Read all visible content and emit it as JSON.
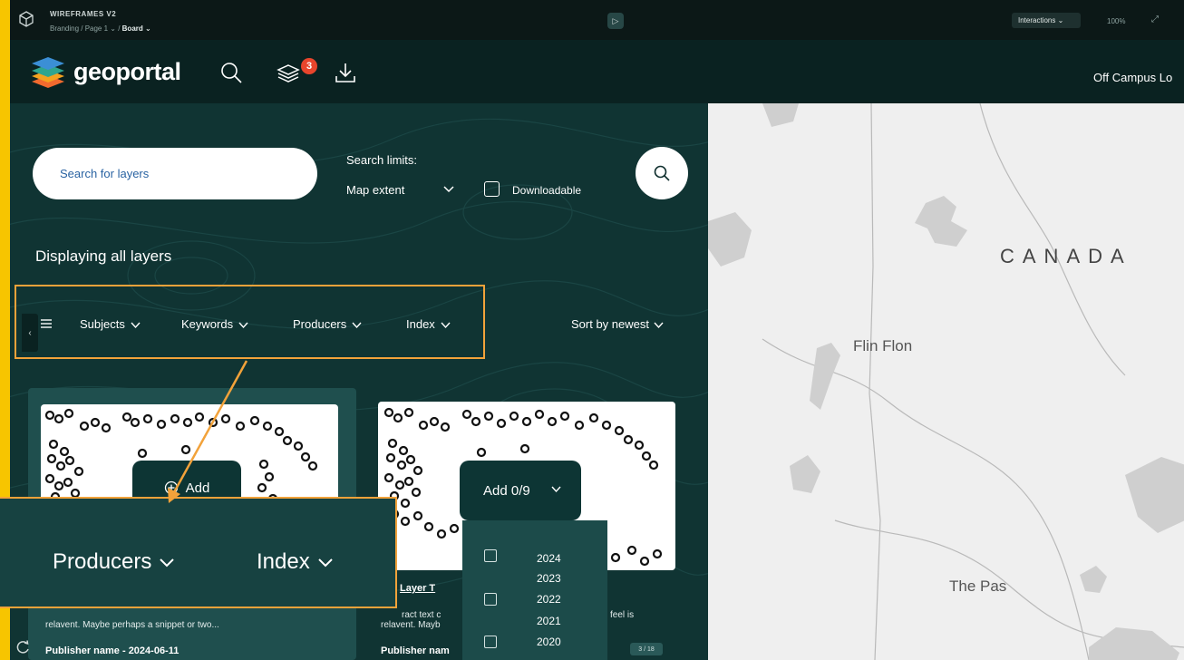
{
  "toolbar": {
    "title": "WIREFRAMES V2",
    "path_prefix": "Branding / Page 1 ⌄ /",
    "path_board": "Board ⌄",
    "interactions_label": "Interactions ⌄",
    "zoom_level": "100%"
  },
  "header": {
    "logo_text": "geoportal",
    "layers_badge_count": "3",
    "off_campus_label": "Off Campus Lo"
  },
  "search": {
    "placeholder": "Search for layers",
    "limits_label": "Search limits:",
    "map_extent_label": "Map extent",
    "downloadable_label": "Downloadable"
  },
  "displaying_label": "Displaying all layers",
  "filters": {
    "subjects": "Subjects",
    "keywords": "Keywords",
    "producers": "Producers",
    "index": "Index",
    "sort": "Sort by newest"
  },
  "cards": [
    {
      "add_label": "Add",
      "snippet": "relavent. Maybe perhaps a snippet or two...",
      "publisher": "Publisher name - 2024-06-11"
    },
    {
      "add_label": "Add 0/9",
      "title": "Layer T",
      "snippet_a": "ract text c",
      "snippet_b": "relavent. Mayb",
      "snippet_c": "feel is",
      "publisher": "Publisher nam",
      "page_badge": "3 / 18"
    }
  ],
  "year_options": [
    "2024",
    "2023",
    "2022",
    "2021",
    "2020"
  ],
  "callout": {
    "producers": "Producers",
    "index": "Index"
  },
  "map": {
    "country_label": "CANADA",
    "places": [
      "Flin Flon",
      "The Pas"
    ]
  },
  "colors": {
    "accent_orange": "#f2a23a",
    "frame_yellow": "#f7c500",
    "panel_teal": "#103433",
    "badge_red": "#e8452c"
  }
}
